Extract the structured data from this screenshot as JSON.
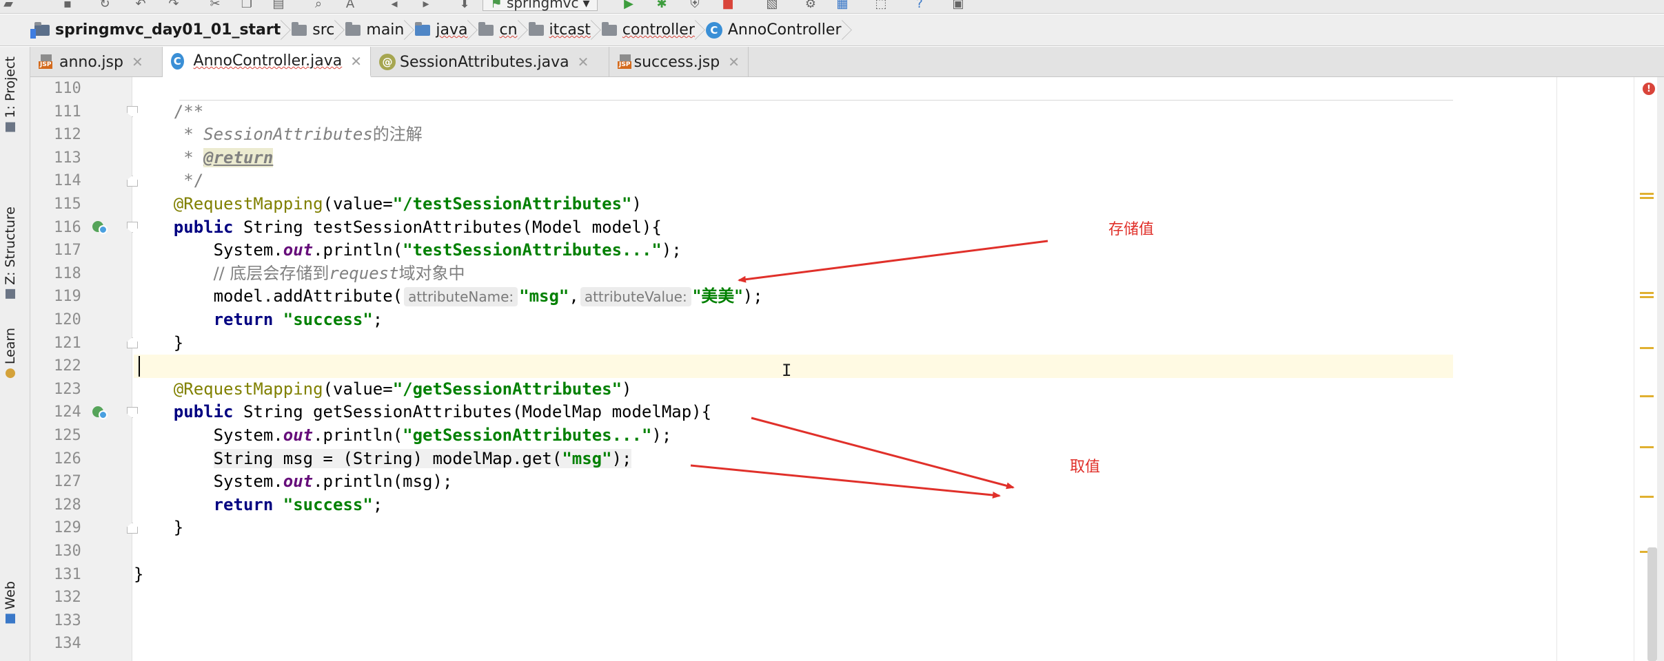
{
  "breadcrumb": [
    {
      "label": "springmvc_day01_01_start",
      "kind": "project"
    },
    {
      "label": "src",
      "kind": "folder"
    },
    {
      "label": "main",
      "kind": "folder"
    },
    {
      "label": "java",
      "kind": "folder"
    },
    {
      "label": "cn",
      "kind": "folder"
    },
    {
      "label": "itcast",
      "kind": "folder"
    },
    {
      "label": "controller",
      "kind": "folder"
    },
    {
      "label": "AnnoController",
      "kind": "class"
    }
  ],
  "toolbar": {
    "run_config": "springmvc"
  },
  "tabs": [
    {
      "label": "anno.jsp",
      "icon": "jsp-icon",
      "active": false
    },
    {
      "label": "AnnoController.java",
      "icon": "class-icon",
      "active": true
    },
    {
      "label": "SessionAttributes.java",
      "icon": "annotation-icon",
      "active": false
    },
    {
      "label": "success.jsp",
      "icon": "jsp-icon",
      "active": false
    }
  ],
  "tool_windows": {
    "project": "1: Project",
    "structure": "Z: Structure",
    "learn": "Learn",
    "web": "Web"
  },
  "editor": {
    "line_numbers": [
      "110",
      "111",
      "112",
      "113",
      "114",
      "115",
      "116",
      "117",
      "118",
      "119",
      "120",
      "121",
      "122",
      "123",
      "124",
      "125",
      "126",
      "127",
      "128",
      "129",
      "130",
      "131",
      "132",
      "133",
      "134"
    ],
    "code": {
      "l111": "/**",
      "l112_a": " * ",
      "l112_b": "SessionAttributes",
      "l112_c": "的注解",
      "l113_a": " * ",
      "l113_b": "@return",
      "l114": " */",
      "l115_a": "@RequestMapping",
      "l115_b": "(value=",
      "l115_c": "\"/testSessionAttributes\"",
      "l115_d": ")",
      "l116_a": "public",
      "l116_b": " String testSessionAttributes(Model model){",
      "l117_a": "System.",
      "l117_b": "out",
      "l117_c": ".println(",
      "l117_d": "\"testSessionAttributes...\"",
      "l117_e": ");",
      "l118_a": "// 底层会存储到",
      "l118_b": "request",
      "l118_c": "域对象中",
      "l119_a": "model.addAttribute(",
      "l119_hint1": "attributeName:",
      "l119_b": "\"msg\"",
      "l119_c": ",",
      "l119_hint2": "attributeValue:",
      "l119_d": "\"美美\"",
      "l119_e": ");",
      "l120_a": "return",
      "l120_b": "\"success\"",
      "l120_c": ";",
      "l121": "}",
      "l123_a": "@RequestMapping",
      "l123_b": "(value=",
      "l123_c": "\"/getSessionAttributes\"",
      "l123_d": ")",
      "l124_a": "public",
      "l124_b": " String getSessionAttributes(ModelMap modelMap){",
      "l125_a": "System.",
      "l125_b": "out",
      "l125_c": ".println(",
      "l125_d": "\"getSessionAttributes...\"",
      "l125_e": ");",
      "l126_a": "String msg = (String) modelMap.get(",
      "l126_b": "\"msg\"",
      "l126_c": ");",
      "l127_a": "System.",
      "l127_b": "out",
      "l127_c": ".println(msg);",
      "l128_a": "return",
      "l128_b": "\"success\"",
      "l128_c": ";",
      "l129": "}",
      "l131": "}"
    }
  },
  "annotations": {
    "store": "存储值",
    "fetch": "取值"
  },
  "colors": {
    "keyword": "#000080",
    "string": "#008000",
    "annotation": "#808000",
    "comment": "#808080",
    "arrow": "#e0302a"
  }
}
